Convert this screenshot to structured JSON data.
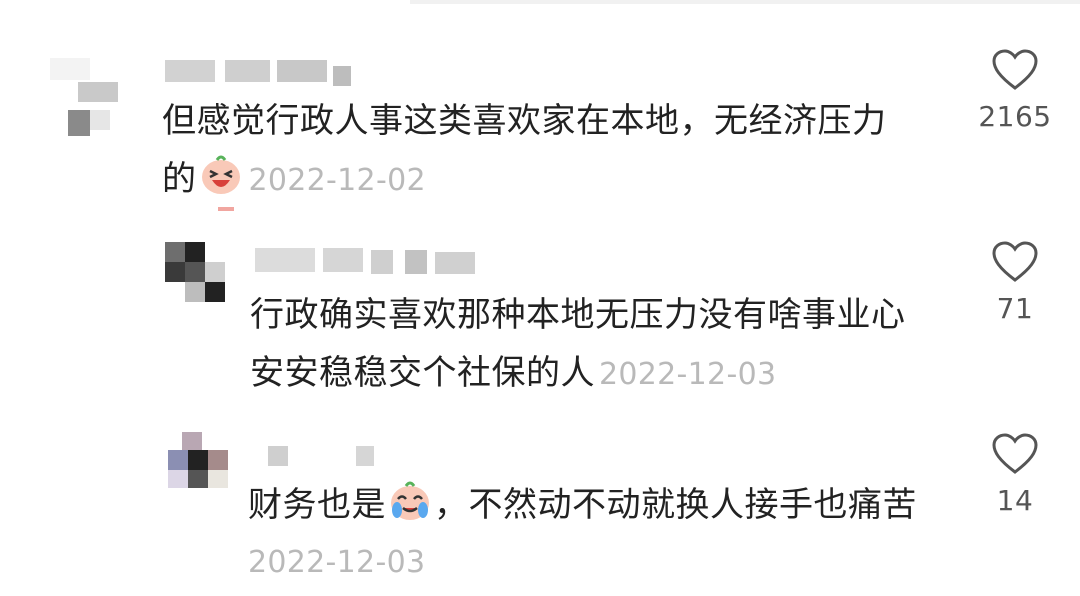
{
  "comments": [
    {
      "text": "但感觉行政人事这类喜欢家在本地，无经济压力的",
      "line1": "但感觉行政人事这类喜欢家在本地，无经济压力",
      "line2": "的",
      "emoji": "laughing-face-icon",
      "date": "2022-12-02",
      "likes": "2165"
    },
    {
      "text": "行政确实喜欢那种本地无压力没有啥事业心安安稳稳交个社保的人",
      "line1": "行政确实喜欢那种本地无压力没有啥事业心",
      "line2": "安安稳稳交个社保的人",
      "date": "2022-12-03",
      "likes": "71"
    },
    {
      "text": "财务也是，不然动不动就换人接手也痛苦",
      "part1": "财务也是",
      "part2": "，不然动不动就换人接手也痛苦",
      "emoji": "crying-face-icon",
      "date": "2022-12-03",
      "likes": "14"
    }
  ],
  "colors": {
    "text": "#222222",
    "date": "#b9b9b9",
    "like_icon": "#555555"
  }
}
